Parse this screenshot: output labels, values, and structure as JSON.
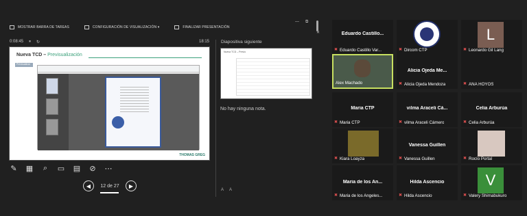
{
  "toolbar": {
    "show_taskbar": "MOSTRAR BARRA DE TAREAS",
    "display_settings": "CONFIGURACIÓN DE VISUALIZACIÓN ▾",
    "end_show": "FINALIZAR PRESENTACIÓN"
  },
  "window": {
    "minimize": "—",
    "restore": "⧉",
    "close": "✕"
  },
  "timer": {
    "elapsed": "0:08:45",
    "pause": "⏸",
    "reset": "↻",
    "clock": "18:15"
  },
  "slide": {
    "title": "Nueva TCD –",
    "title_accent": "Previsualización",
    "mini_button": "Previsualizar",
    "brand": "THOMAS GREG"
  },
  "navigation": {
    "page": "12 de 27",
    "prev": "◀",
    "next": "▶"
  },
  "next_slide": {
    "label": "Diapositiva siguiente",
    "thumb_title": "Nueva TCD – Previo"
  },
  "notes": {
    "text": "No hay ninguna nota."
  },
  "font_controls": {
    "increase": "A",
    "decrease": "A"
  },
  "participants": [
    {
      "display": "Eduardo Castillo...",
      "label": "Eduardo Castillo Var..."
    },
    {
      "display": "",
      "label": "Dircom CTP"
    },
    {
      "display": "L",
      "label": "Leonardo Gil Lang"
    },
    {
      "display": "",
      "label": "Alex Machado"
    },
    {
      "display": "Alicia Ojeda Me...",
      "label": "Alicia Ojeda Mendoza"
    },
    {
      "display": "",
      "label": "ANA HOYOS"
    },
    {
      "display": "Maria CTP",
      "label": "Maria CTP"
    },
    {
      "display": "vilma Araceli Cá...",
      "label": "vilma Araceli Cámero"
    },
    {
      "display": "Celia Arburúa",
      "label": "Celia Arburúa"
    },
    {
      "display": "",
      "label": "Kiara Loayza"
    },
    {
      "display": "Vanessa Guillen",
      "label": "Vanessa Guillen"
    },
    {
      "display": "",
      "label": "Rocío Portal"
    },
    {
      "display": "Maria de los An...",
      "label": "Maria de los Angeles..."
    },
    {
      "display": "Hilda Ascencio",
      "label": "Hilda Ascencio"
    },
    {
      "display": "V",
      "label": "Valery Shimabukuro"
    }
  ]
}
